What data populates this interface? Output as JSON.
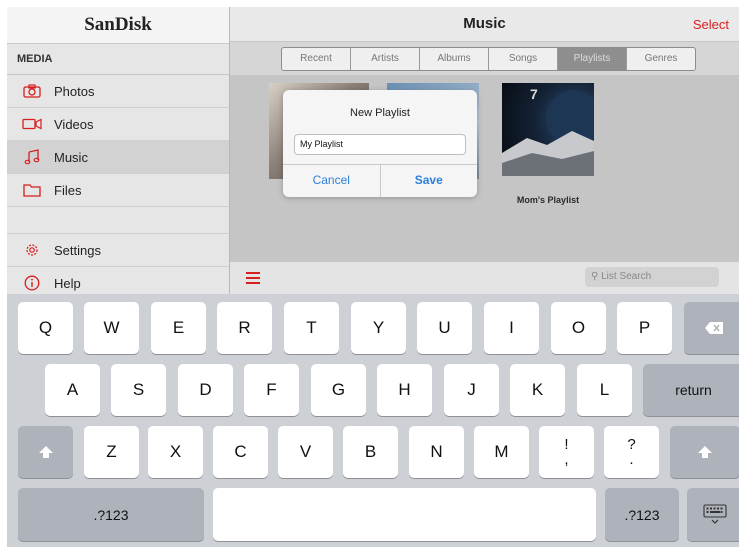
{
  "brand": "SanDisk",
  "sidebar": {
    "section": "MEDIA",
    "media_items": [
      {
        "label": "Photos",
        "icon": "camera-icon"
      },
      {
        "label": "Videos",
        "icon": "video-icon"
      },
      {
        "label": "Music",
        "icon": "music-note-icon"
      },
      {
        "label": "Files",
        "icon": "folder-icon"
      }
    ],
    "settings": "Settings",
    "help": "Help"
  },
  "header": {
    "title": "Music",
    "select": "Select"
  },
  "tabs": [
    "Recent",
    "Artists",
    "Albums",
    "Songs",
    "Playlists",
    "Genres"
  ],
  "active_tab": "Playlists",
  "playlist_label": "Mom's Playlist",
  "list_search_placeholder": "List Search",
  "dialog": {
    "title": "New Playlist",
    "input_value": "My Playlist",
    "cancel": "Cancel",
    "save": "Save"
  },
  "keyboard": {
    "row1": [
      "Q",
      "W",
      "E",
      "R",
      "T",
      "Y",
      "U",
      "I",
      "O",
      "P"
    ],
    "row2": [
      "A",
      "S",
      "D",
      "F",
      "G",
      "H",
      "J",
      "K",
      "L"
    ],
    "return": "return",
    "row3": [
      "Z",
      "X",
      "C",
      "V",
      "B",
      "N",
      "M"
    ],
    "punct1": [
      "!",
      ","
    ],
    "punct2": [
      "?",
      "."
    ],
    "numbers_left": ".?123",
    "numbers_right": ".?123"
  },
  "colors": {
    "accent": "#d81e1e",
    "link": "#2d7fdc"
  }
}
